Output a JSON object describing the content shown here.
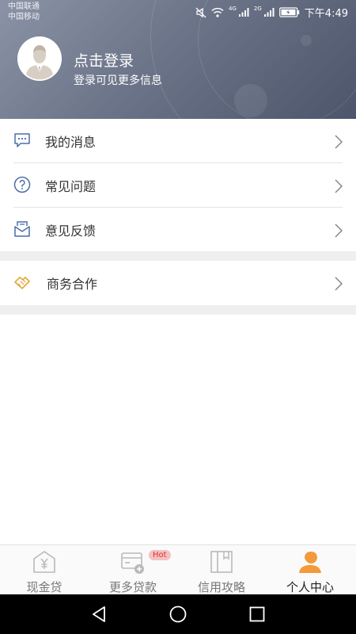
{
  "status_bar": {
    "carrier_1": "中国联通",
    "carrier_2": "中国移动",
    "net_1": "4G",
    "net_2": "2G",
    "time": "下午4:49"
  },
  "profile": {
    "title": "点击登录",
    "subtitle": "登录可见更多信息"
  },
  "menu": {
    "items": [
      {
        "label": "我的消息",
        "icon": "message-icon"
      },
      {
        "label": "常见问题",
        "icon": "question-icon"
      },
      {
        "label": "意见反馈",
        "icon": "feedback-icon"
      }
    ],
    "business": {
      "label": "商务合作",
      "icon": "handshake-icon"
    }
  },
  "tabs": [
    {
      "label": "现金贷",
      "icon": "cash-loan-icon"
    },
    {
      "label": "更多贷款",
      "icon": "card-add-icon",
      "badge": "Hot"
    },
    {
      "label": "信用攻略",
      "icon": "book-icon"
    },
    {
      "label": "个人中心",
      "icon": "person-icon",
      "active": true
    }
  ],
  "colors": {
    "accent": "#f39a3a",
    "header_start": "#8b93a6",
    "header_end": "#4d556c",
    "icon_blue": "#4a6ea8",
    "business_icon": "#e2a83a",
    "hot_badge_bg": "#f6c1c1",
    "hot_badge_text": "#d9342b"
  }
}
